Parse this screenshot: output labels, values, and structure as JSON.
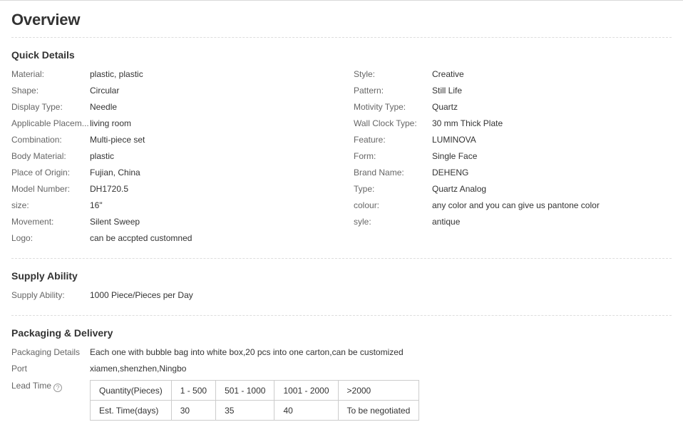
{
  "page": {
    "title": "Overview"
  },
  "quick_details": {
    "title": "Quick Details",
    "left": [
      {
        "label": "Material:",
        "value": "plastic, plastic"
      },
      {
        "label": "Shape:",
        "value": "Circular"
      },
      {
        "label": "Display Type:",
        "value": "Needle"
      },
      {
        "label": "Applicable Placem...",
        "value": "living room"
      },
      {
        "label": "Combination:",
        "value": "Multi-piece set"
      },
      {
        "label": "Body Material:",
        "value": "plastic"
      },
      {
        "label": "Place of Origin:",
        "value": "Fujian, China"
      },
      {
        "label": "Model Number:",
        "value": "DH1720.5"
      },
      {
        "label": "size:",
        "value": "16\""
      },
      {
        "label": "Movement:",
        "value": "Silent Sweep"
      },
      {
        "label": "Logo:",
        "value": "can be accpted customned"
      }
    ],
    "right": [
      {
        "label": "Style:",
        "value": "Creative"
      },
      {
        "label": "Pattern:",
        "value": "Still Life"
      },
      {
        "label": "Motivity Type:",
        "value": "Quartz"
      },
      {
        "label": "Wall Clock Type:",
        "value": "30 mm Thick Plate"
      },
      {
        "label": "Feature:",
        "value": "LUMINOVA"
      },
      {
        "label": "Form:",
        "value": "Single Face"
      },
      {
        "label": "Brand Name:",
        "value": "DEHENG"
      },
      {
        "label": "Type:",
        "value": "Quartz Analog"
      },
      {
        "label": "colour:",
        "value": "any color and you can give us pantone color"
      },
      {
        "label": "syle:",
        "value": "antique"
      }
    ]
  },
  "supply": {
    "title": "Supply Ability",
    "label": "Supply Ability:",
    "value": "1000 Piece/Pieces per Day"
  },
  "packaging": {
    "title": "Packaging & Delivery",
    "details_label": "Packaging Details",
    "details_value": "Each one with bubble bag into white box,20 pcs into one carton,can be customized",
    "port_label": "Port",
    "port_value": "xiamen,shenzhen,Ningbo",
    "lead_label": "Lead Time",
    "help_glyph": "?",
    "lead_table": {
      "quantity_header": "Quantity(Pieces)",
      "time_header": "Est. Time(days)",
      "ranges": [
        "1 - 500",
        "501 - 1000",
        "1001 - 2000",
        ">2000"
      ],
      "times": [
        "30",
        "35",
        "40",
        "To be negotiated"
      ]
    }
  }
}
